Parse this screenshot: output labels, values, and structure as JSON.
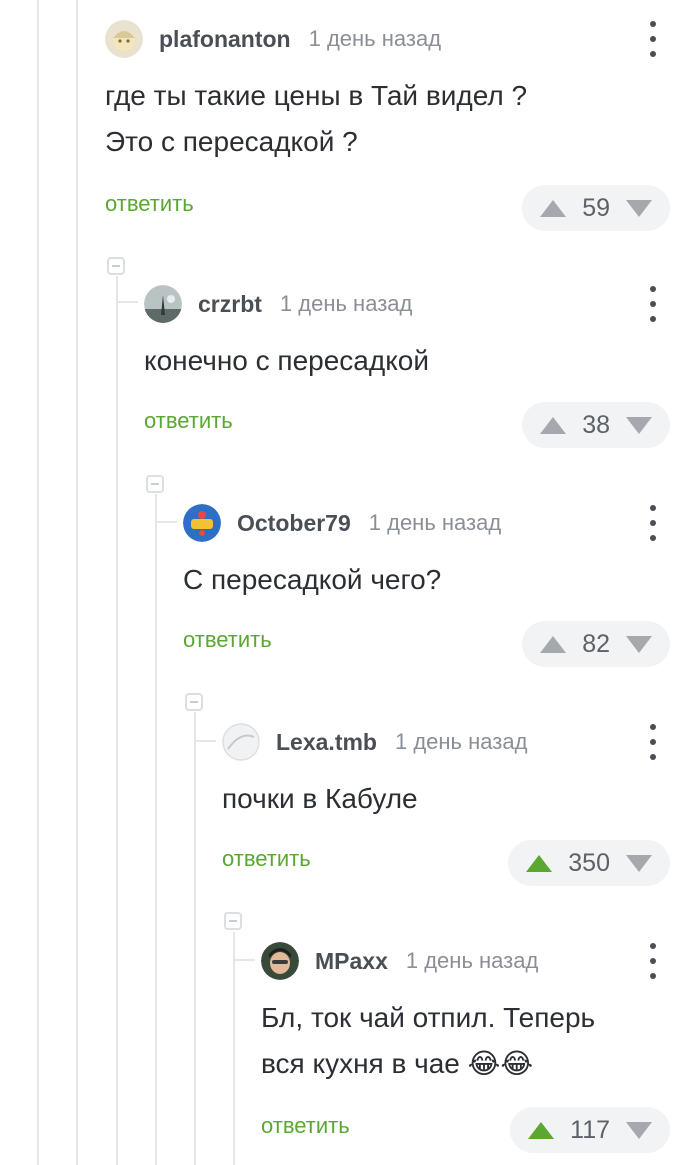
{
  "reply_label": "ответить",
  "comments": [
    {
      "author": "plafonanton",
      "time": "1 день назад",
      "text": "где ты такие цены в Тай видел ?\nЭто с пересадкой ?",
      "rating": "59",
      "upvoted": false,
      "avatar": "avatar-plafonanton"
    },
    {
      "author": "crzrbt",
      "time": "1 день назад",
      "text": "конечно с пересадкой",
      "rating": "38",
      "upvoted": false,
      "avatar": "avatar-crzrbt"
    },
    {
      "author": "October79",
      "time": "1 день назад",
      "text": "С пересадкой чего?",
      "rating": "82",
      "upvoted": false,
      "avatar": "avatar-october79"
    },
    {
      "author": "Lexa.tmb",
      "time": "1 день назад",
      "text": "почки в Кабуле",
      "rating": "350",
      "upvoted": true,
      "avatar": "avatar-lexa"
    },
    {
      "author": "MPaxx",
      "time": "1 день назад",
      "text": "Бл, ток чай отпил. Теперь\nвся кухня в чае 😂😂",
      "rating": "117",
      "upvoted": true,
      "avatar": "avatar-mpaxx"
    }
  ],
  "colors": {
    "accent": "#5aa832",
    "rail": "#e4e6e8",
    "muted": "#8a8f96"
  },
  "icons": [
    "collapse-icon",
    "more-options-icon",
    "upvote-icon",
    "downvote-icon"
  ]
}
